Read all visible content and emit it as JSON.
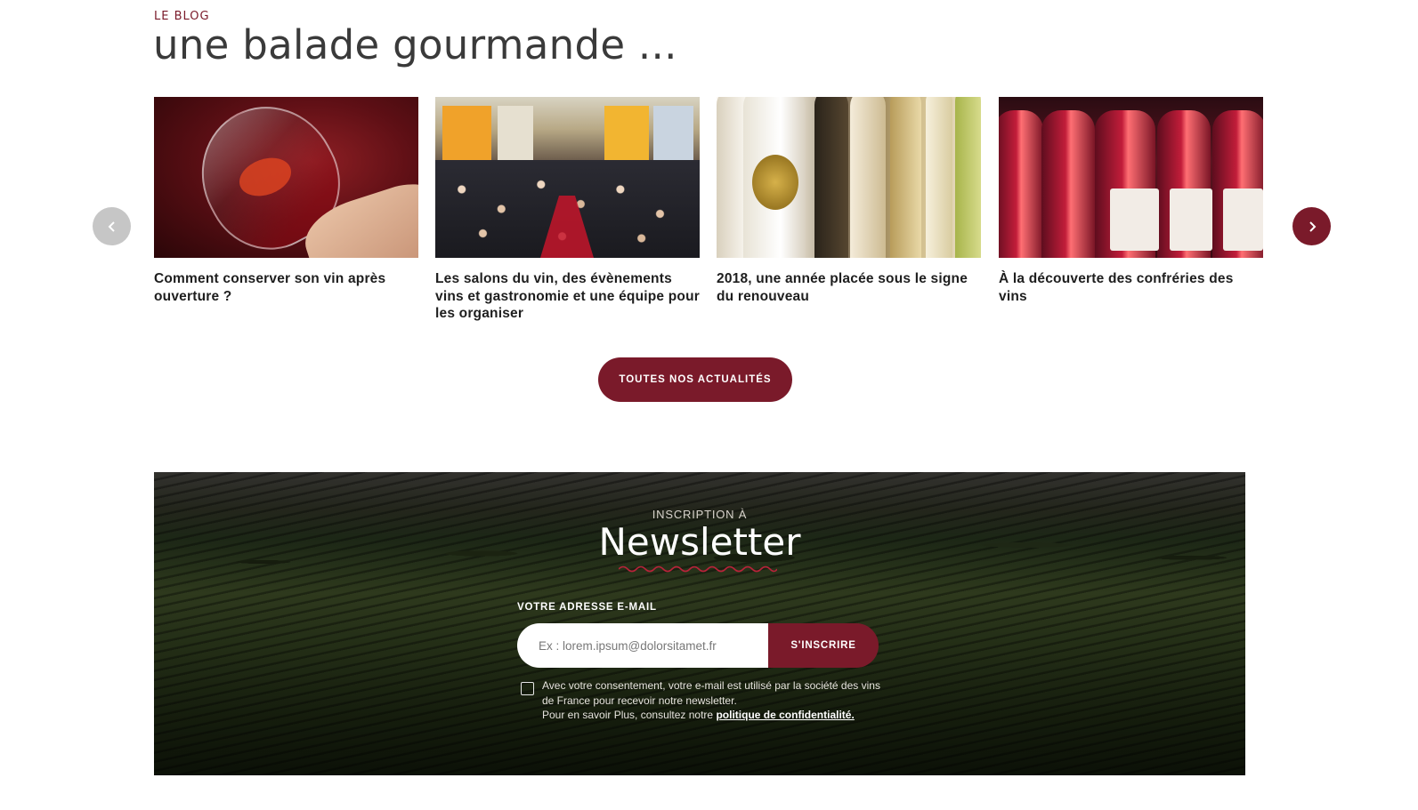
{
  "blog": {
    "eyebrow": "LE BLOG",
    "title": "une balade gourmande ...",
    "articles": [
      {
        "title": "Comment conserver son vin après ouverture ?",
        "image": "wine-glass-photo"
      },
      {
        "title": "Les salons du vin, des évènements vins et gastronomie et une équipe pour les organiser",
        "image": "wine-fair-crowd-photo"
      },
      {
        "title": "2018, une année placée sous le signe du renouveau",
        "image": "wine-bottles-photo"
      },
      {
        "title": "À la découverte des confréries des vins",
        "image": "rose-wine-bottles-photo"
      }
    ],
    "prev_icon": "chevron-left-icon",
    "next_icon": "chevron-right-icon",
    "cta_label": "TOUTES NOS ACTUALITÉS"
  },
  "newsletter": {
    "eyebrow": "INSCRIPTION À",
    "title": "Newsletter",
    "email_label": "VOTRE ADRESSE E-MAIL",
    "email_placeholder": "Ex : lorem.ipsum@dolorsitamet.fr",
    "email_value": "",
    "submit_label": "S'INSCRIRE",
    "consent_text": "Avec votre consentement, votre e-mail est utilisé par la société des vins de France pour recevoir notre newsletter.",
    "consent_more": "Pour en savoir Plus, consultez notre",
    "privacy_link": "politique de confidentialité.",
    "consent_checked": false
  },
  "colors": {
    "accent": "#7a1a2a",
    "prev_arrow": "#c6c6c6",
    "text_dark": "#3a3a3a"
  }
}
